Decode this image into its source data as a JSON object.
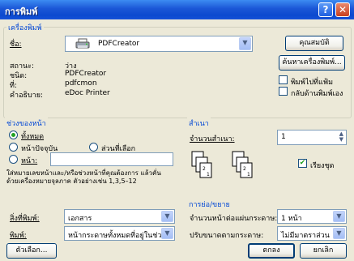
{
  "window": {
    "title": "การพิมพ์",
    "help_glyph": "?",
    "close_glyph": "✕"
  },
  "printer": {
    "group_label": "เครื่องพิมพ์",
    "name_label": "ชื่อ:",
    "selected": "PDFCreator",
    "properties_button": "คุณสมบัติ",
    "find_button": "ค้นหาเครื่องพิมพ์...",
    "status_label": "สถานะ:",
    "status_value": "ว่าง",
    "type_label": "ชนิด:",
    "type_value": "PDFCreator",
    "where_label": "ที่:",
    "where_value": "pdfcmon",
    "comment_label": "คำอธิบาย:",
    "comment_value": "eDoc Printer",
    "print_to_file": "พิมพ์ไปที่แฟ้ม",
    "manual_duplex": "กลับด้านพิมพ์เอง",
    "print_to_file_checked": false,
    "manual_duplex_checked": false
  },
  "page_range": {
    "group_label": "ช่วงของหน้า",
    "all": "ทั้งหมด",
    "current": "หน้าปัจจุบัน",
    "selection": "ส่วนที่เลือก",
    "pages": "หน้า:",
    "pages_value": "",
    "hint": "ใส่หมายเลขหน้าและ/หรือช่วงหน้าที่คุณต้องการ แล้วคั่นด้วยเครื่องหมายจุลภาค ตัวอย่างเช่น 1,3,5–12"
  },
  "copies": {
    "group_label": "สำเนา",
    "count_label": "จำนวนสำเนา:",
    "count_value": "1",
    "collate": "เรียงชุด",
    "collate_checked": true
  },
  "print_what": {
    "label": "สิ่งที่พิมพ์:",
    "value": "เอกสาร"
  },
  "print": {
    "label": "พิมพ์:",
    "value": "หน้ากระดาษทั้งหมดที่อยู่ในช่วง"
  },
  "zoom": {
    "group_label": "การย่อ/ขยาย",
    "pages_per_sheet_label": "จำนวนหน้าต่อแผ่นกระดาษ:",
    "pages_per_sheet_value": "1 หน้า",
    "scale_label": "ปรับขนาดตามกระดาษ:",
    "scale_value": "ไม่มีมาตราส่วน"
  },
  "buttons": {
    "options": "ตัวเลือก...",
    "ok": "ตกลง",
    "cancel": "ยกเลิก"
  }
}
